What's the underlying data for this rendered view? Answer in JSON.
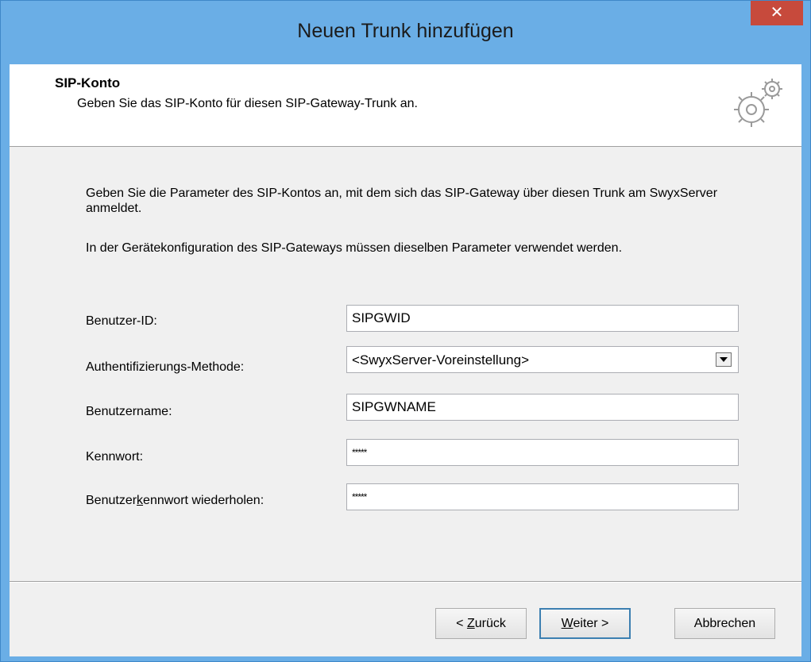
{
  "window": {
    "title": "Neuen Trunk hinzufügen",
    "close_glyph": "✕"
  },
  "header": {
    "title": "SIP-Konto",
    "subtitle": "Geben Sie das SIP-Konto für diesen SIP-Gateway-Trunk an.",
    "icon": "gears-icon"
  },
  "body": {
    "paragraph1": "Geben Sie die Parameter des SIP-Kontos an, mit dem sich das SIP-Gateway über diesen Trunk am SwyxServer anmeldet.",
    "paragraph2": "In der Gerätekonfiguration des SIP-Gateways müssen dieselben Parameter verwendet werden."
  },
  "form": {
    "user_id": {
      "label": "Benutzer-ID:",
      "value": "SIPGWID"
    },
    "auth_method": {
      "label": "Authentifizierungs-Methode:",
      "value": "<SwyxServer-Voreinstellung>"
    },
    "username": {
      "label": "Benutzername:",
      "value": "SIPGWNAME"
    },
    "password": {
      "label": "Kennwort:",
      "value": "*****"
    },
    "password_repeat": {
      "label_pre": "Benutzer",
      "label_accel": "k",
      "label_post": "ennwort wiederholen:",
      "value": "*****"
    }
  },
  "buttons": {
    "back": {
      "pre": "< ",
      "accel": "Z",
      "post": "urück"
    },
    "next": {
      "pre": "",
      "accel": "W",
      "post": "eiter >"
    },
    "cancel": {
      "label": "Abbrechen"
    }
  },
  "colors": {
    "titlebar": "#6aaee6",
    "close": "#c74a3c",
    "client": "#f0f0f0"
  }
}
